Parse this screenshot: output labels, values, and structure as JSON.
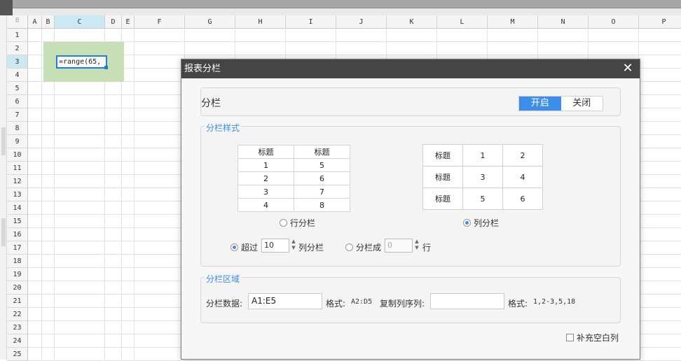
{
  "sheet": {
    "columns": [
      "A",
      "B",
      "C",
      "D",
      "E",
      "F",
      "G",
      "H",
      "I",
      "J",
      "K",
      "L",
      "M",
      "N",
      "O",
      "P"
    ],
    "selected_column": "C",
    "rows": [
      "1",
      "2",
      "3",
      "4",
      "5",
      "6",
      "7",
      "8",
      "9",
      "10",
      "11",
      "12",
      "13",
      "14",
      "15",
      "16",
      "17",
      "18",
      "19",
      "20",
      "21",
      "22",
      "23",
      "24",
      "25"
    ],
    "selected_row": "3",
    "active_cell_formula": "=range(65,",
    "fill_color": "#c6dfb4",
    "accent_color": "#1e7fd6"
  },
  "dialog": {
    "title": "报表分栏",
    "close_icon": "close-icon",
    "enable": {
      "label": "分栏",
      "on_label": "开启",
      "off_label": "关闭",
      "selected": "开启"
    },
    "style_section": {
      "title": "分栏样式",
      "row_table": {
        "header": [
          "标题",
          "标题"
        ],
        "rows": [
          [
            "1",
            "5"
          ],
          [
            "2",
            "6"
          ],
          [
            "3",
            "7"
          ],
          [
            "4",
            "8"
          ]
        ]
      },
      "col_table": {
        "rows": [
          [
            "标题",
            "1",
            "2"
          ],
          [
            "标题",
            "3",
            "4"
          ],
          [
            "标题",
            "5",
            "6"
          ]
        ]
      },
      "row_option": "行分栏",
      "col_option": "列分栏",
      "selected_option": "列分栏",
      "exceed_label": "超过",
      "exceed_value": "10",
      "exceed_suffix": "列分栏",
      "split_label": "分栏成",
      "split_value": "0",
      "split_suffix": "行",
      "selected_mode": "超过"
    },
    "area_section": {
      "title": "分栏区域",
      "data_label": "分栏数据:",
      "data_value": "A1:E5",
      "format_label_1": "格式:",
      "format_hint_1": "A2:D5",
      "copy_label": "复制列序列:",
      "copy_value": "",
      "format_label_2": "格式:",
      "format_hint_2": "1,2-3,5,18"
    },
    "fill_blank_label": "补充空白列",
    "accent_color": "#3d8ee8"
  }
}
